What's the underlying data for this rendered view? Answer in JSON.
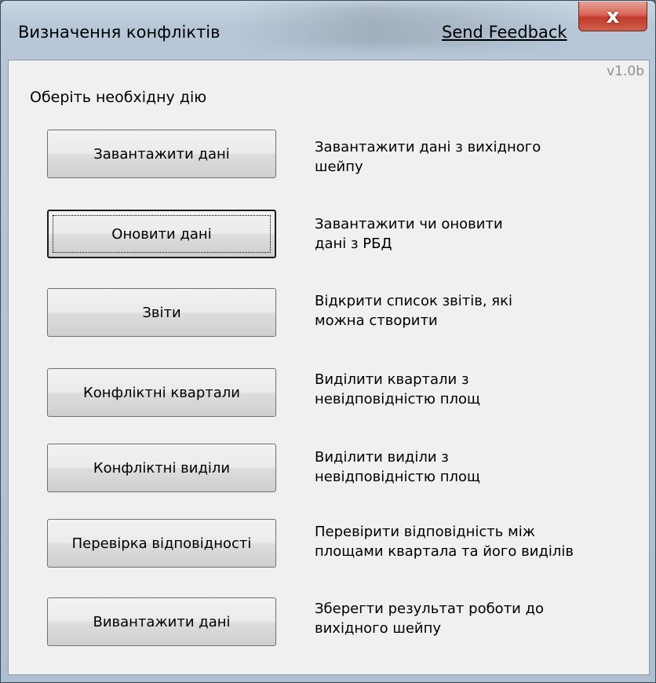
{
  "window": {
    "title": "Визначення конфліктів",
    "feedback_link": "Send Feedback",
    "close_glyph": "x"
  },
  "panel": {
    "version": "v1.0b",
    "prompt": "Оберіть необхідну дію"
  },
  "actions": [
    {
      "label": "Завантажити дані",
      "desc_line1": "Завантажити дані з вихідного",
      "desc_line2": "шейпу"
    },
    {
      "label": "Оновити дані",
      "desc_line1": "Завантажити чи оновити",
      "desc_line2": "дані з РБД",
      "is_default": true
    },
    {
      "label": "Звіти",
      "desc_line1": "Відкрити список звітів, які",
      "desc_line2": "можна створити"
    },
    {
      "label": "Конфліктні квартали",
      "desc_line1": "Виділити квартали з",
      "desc_line2": "невідповідністю площ"
    },
    {
      "label": "Конфліктні виділи",
      "desc_line1": "Виділити виділи з",
      "desc_line2": "невідповідністю площ"
    },
    {
      "label": "Перевірка відповідності",
      "desc_line1": "Перевірити відповідність між",
      "desc_line2": "площами квартала та його виділів"
    },
    {
      "label": "Вивантажити дані",
      "desc_line1": "Зберегти результат роботи до",
      "desc_line2": "вихідного шейпу"
    }
  ]
}
